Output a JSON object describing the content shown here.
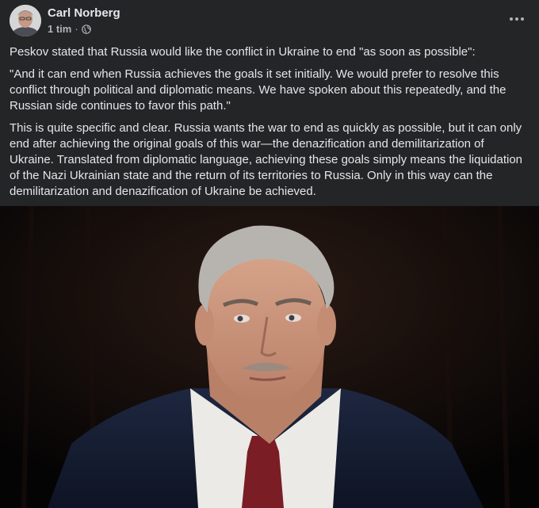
{
  "post": {
    "author": "Carl Norberg",
    "time": "1 tim",
    "separator": "·",
    "audience_icon": "globe-icon",
    "more_icon": "more-options-icon",
    "paragraphs": [
      "Peskov stated that Russia would like the conflict in Ukraine to end \"as soon as possible\":",
      "\"And it can end when Russia achieves the goals it set initially. We would prefer to resolve this conflict through political and diplomatic means. We have spoken about this repeatedly, and the Russian side continues to favor this path.\"",
      "This is quite specific and clear. Russia wants the war to end as quickly as possible, but it can only end after achieving the original goals of this war—the denazification and demilitarization of Ukraine. Translated from diplomatic language, achieving these goals simply means the liquidation of the Nazi Ukrainian state and the return of its territories to Russia. Only in this way can the demilitarization and denazification of Ukraine be achieved."
    ]
  },
  "colors": {
    "background": "#242526",
    "text_primary": "#e4e6eb",
    "text_secondary": "#b0b3b8"
  }
}
